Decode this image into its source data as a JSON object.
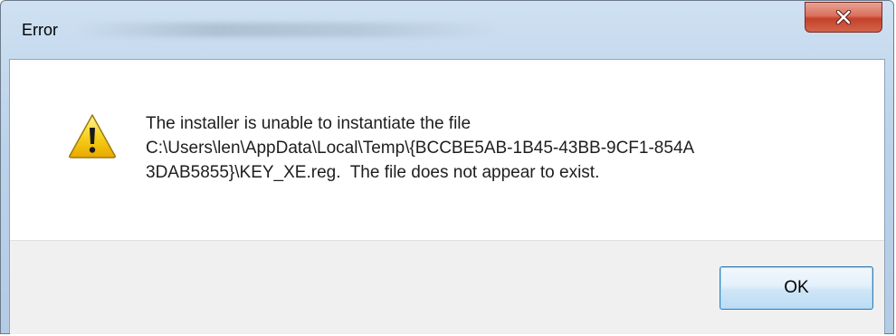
{
  "window": {
    "title": "Error"
  },
  "titlebar": {
    "close_icon": "close-icon"
  },
  "message": {
    "icon": "warning-icon",
    "lines": [
      "The installer is unable to instantiate the file",
      "C:\\Users\\len\\AppData\\Local\\Temp\\{BCCBE5AB-1B45-43BB-9CF1-854A",
      "3DAB5855}\\KEY_XE.reg.  The file does not appear to exist."
    ]
  },
  "buttons": {
    "ok_label": "OK"
  },
  "colors": {
    "close_button": "#c4412b",
    "warning_yellow": "#f5c400",
    "ok_border": "#3c7fb1"
  }
}
